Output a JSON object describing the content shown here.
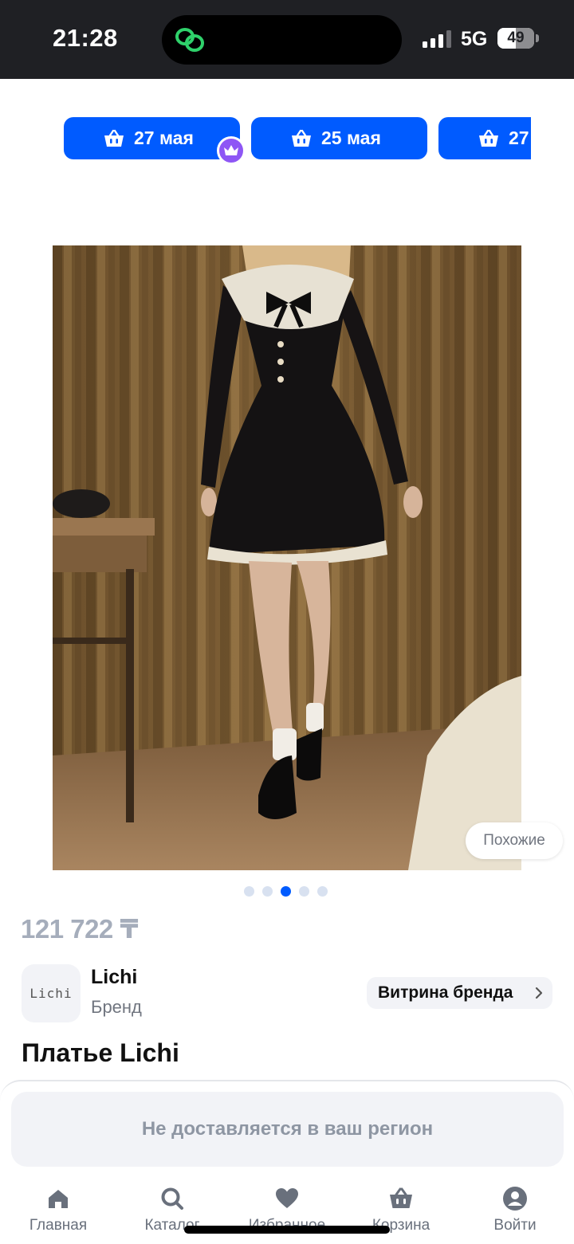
{
  "status_bar": {
    "time": "21:28",
    "network": "5G",
    "battery": "49",
    "battery_level": 0.49,
    "signal_bars_active": 3
  },
  "delivery_chips": [
    {
      "label": "27 мая",
      "icon": "cart-icon"
    },
    {
      "label": "25 мая",
      "icon": "cart-icon"
    },
    {
      "label": "27",
      "icon": "cart-icon"
    }
  ],
  "premium_badge": {
    "icon": "crown-icon",
    "color": "#8e56f5"
  },
  "gallery": {
    "similar_label": "Похожие",
    "page_count": 5,
    "active_page": 3
  },
  "product": {
    "price": "121 722 ₸",
    "title": "Платье Lichi"
  },
  "brand": {
    "logo_text": "Lichi",
    "name": "Lichi",
    "subtitle": "Бренд",
    "store_button": "Витрина бренда"
  },
  "notice": {
    "text": "Не доставляется в ваш регион"
  },
  "bottom_nav": [
    {
      "label": "Главная",
      "icon": "home-icon"
    },
    {
      "label": "Каталог",
      "icon": "search-icon"
    },
    {
      "label": "Избранное",
      "icon": "heart-icon"
    },
    {
      "label": "Корзина",
      "icon": "cart-icon"
    },
    {
      "label": "Войти",
      "icon": "profile-icon"
    }
  ],
  "colors": {
    "accent": "#005bff",
    "status_bar": "#1f2024",
    "muted_text": "#8e96a3"
  }
}
